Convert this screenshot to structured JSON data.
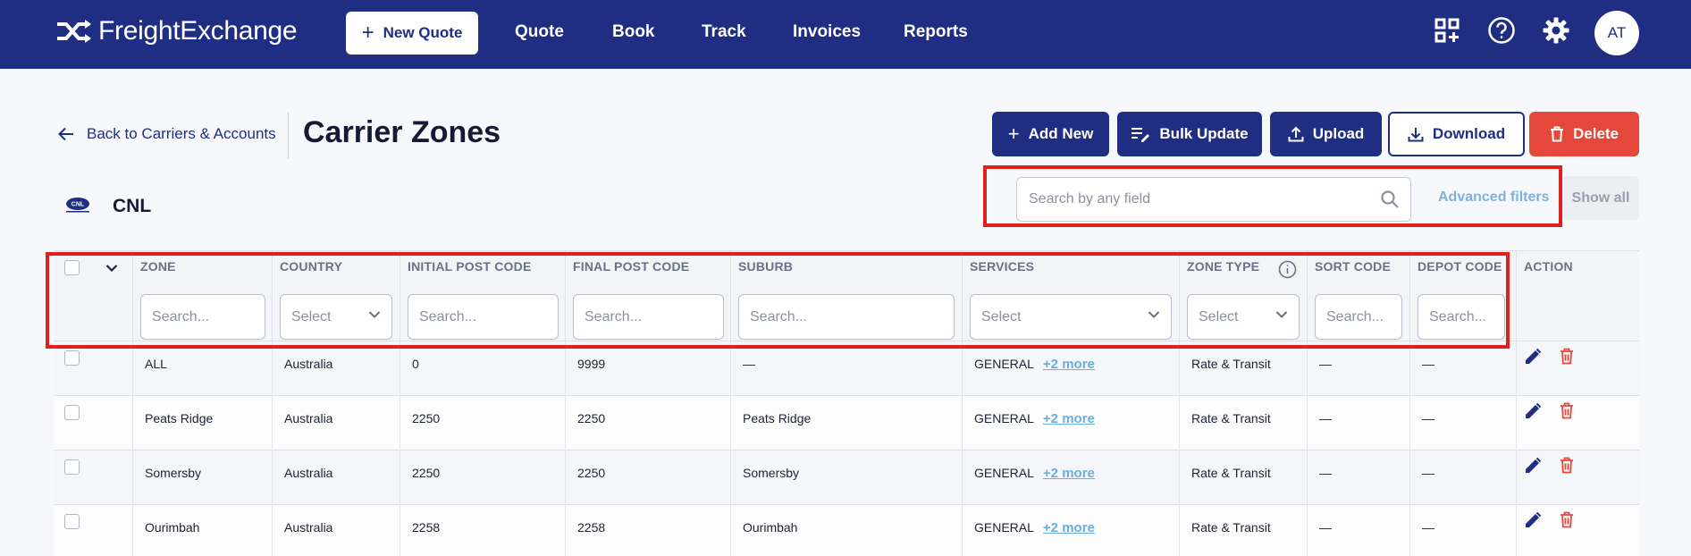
{
  "nav": {
    "brand": "FreightExchange",
    "new_quote": "New Quote",
    "links": [
      "Quote",
      "Book",
      "Track",
      "Invoices",
      "Reports"
    ],
    "icons": [
      "apps-add-icon",
      "help-icon",
      "gear-icon"
    ],
    "avatar": "AT"
  },
  "header": {
    "back_label": "Back to Carriers & Accounts",
    "title": "Carrier Zones",
    "buttons": {
      "add_new": "Add New",
      "bulk_update": "Bulk Update",
      "upload": "Upload",
      "download": "Download",
      "delete": "Delete"
    }
  },
  "carrier": {
    "logo_text": "CNL",
    "name": "CNL"
  },
  "search": {
    "placeholder": "Search by any field",
    "advanced_filters": "Advanced filters",
    "show_all": "Show all"
  },
  "table": {
    "columns": {
      "zone": {
        "label": "ZONE",
        "filter": "Search..."
      },
      "country": {
        "label": "COUNTRY",
        "filter": "Select"
      },
      "initial_post_code": {
        "label": "INITIAL POST CODE",
        "filter": "Search..."
      },
      "final_post_code": {
        "label": "FINAL POST CODE",
        "filter": "Search..."
      },
      "suburb": {
        "label": "SUBURB",
        "filter": "Search..."
      },
      "services": {
        "label": "SERVICES",
        "filter": "Select"
      },
      "zone_type": {
        "label": "ZONE TYPE",
        "filter": "Select"
      },
      "sort_code": {
        "label": "SORT CODE",
        "filter": "Search..."
      },
      "depot_code": {
        "label": "DEPOT CODE",
        "filter": "Search..."
      },
      "action": {
        "label": "ACTION"
      }
    },
    "rows": [
      {
        "zone": "ALL",
        "country": "Australia",
        "initial": "0",
        "final": "9999",
        "suburb": "—",
        "service": "GENERAL",
        "more": "+2 more",
        "zone_type": "Rate & Transit",
        "sort_code": "—",
        "depot_code": "—"
      },
      {
        "zone": "Peats Ridge",
        "country": "Australia",
        "initial": "2250",
        "final": "2250",
        "suburb": "Peats Ridge",
        "service": "GENERAL",
        "more": "+2 more",
        "zone_type": "Rate & Transit",
        "sort_code": "—",
        "depot_code": "—"
      },
      {
        "zone": "Somersby",
        "country": "Australia",
        "initial": "2250",
        "final": "2250",
        "suburb": "Somersby",
        "service": "GENERAL",
        "more": "+2 more",
        "zone_type": "Rate & Transit",
        "sort_code": "—",
        "depot_code": "—"
      },
      {
        "zone": "Ourimbah",
        "country": "Australia",
        "initial": "2258",
        "final": "2258",
        "suburb": "Ourimbah",
        "service": "GENERAL",
        "more": "+2 more",
        "zone_type": "Rate & Transit",
        "sort_code": "—",
        "depot_code": "—"
      }
    ]
  },
  "colors": {
    "brand": "#1f2e82",
    "danger": "#e5473a",
    "link": "#6aaee0",
    "highlight": "#e0201b"
  }
}
